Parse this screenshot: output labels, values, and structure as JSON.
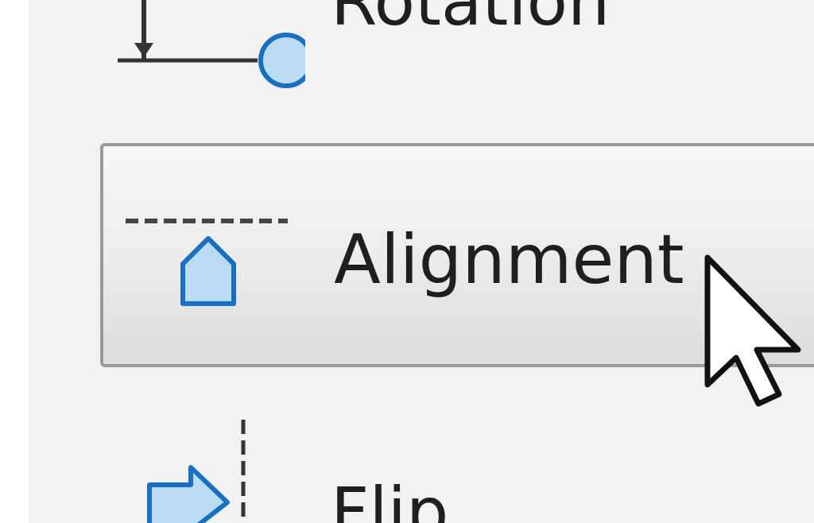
{
  "menu": {
    "items": [
      {
        "label": "Rotation",
        "icon": "rotation-icon"
      },
      {
        "label": "Alignment",
        "icon": "alignment-icon",
        "state": "hovered"
      },
      {
        "label": "Flip",
        "icon": "flip-icon"
      }
    ]
  },
  "colors": {
    "icon_fill": "#b9dcf2",
    "icon_stroke": "#1a6fc0",
    "panel_bg": "#f2f2f2",
    "highlight_border": "#9a9a9a"
  }
}
